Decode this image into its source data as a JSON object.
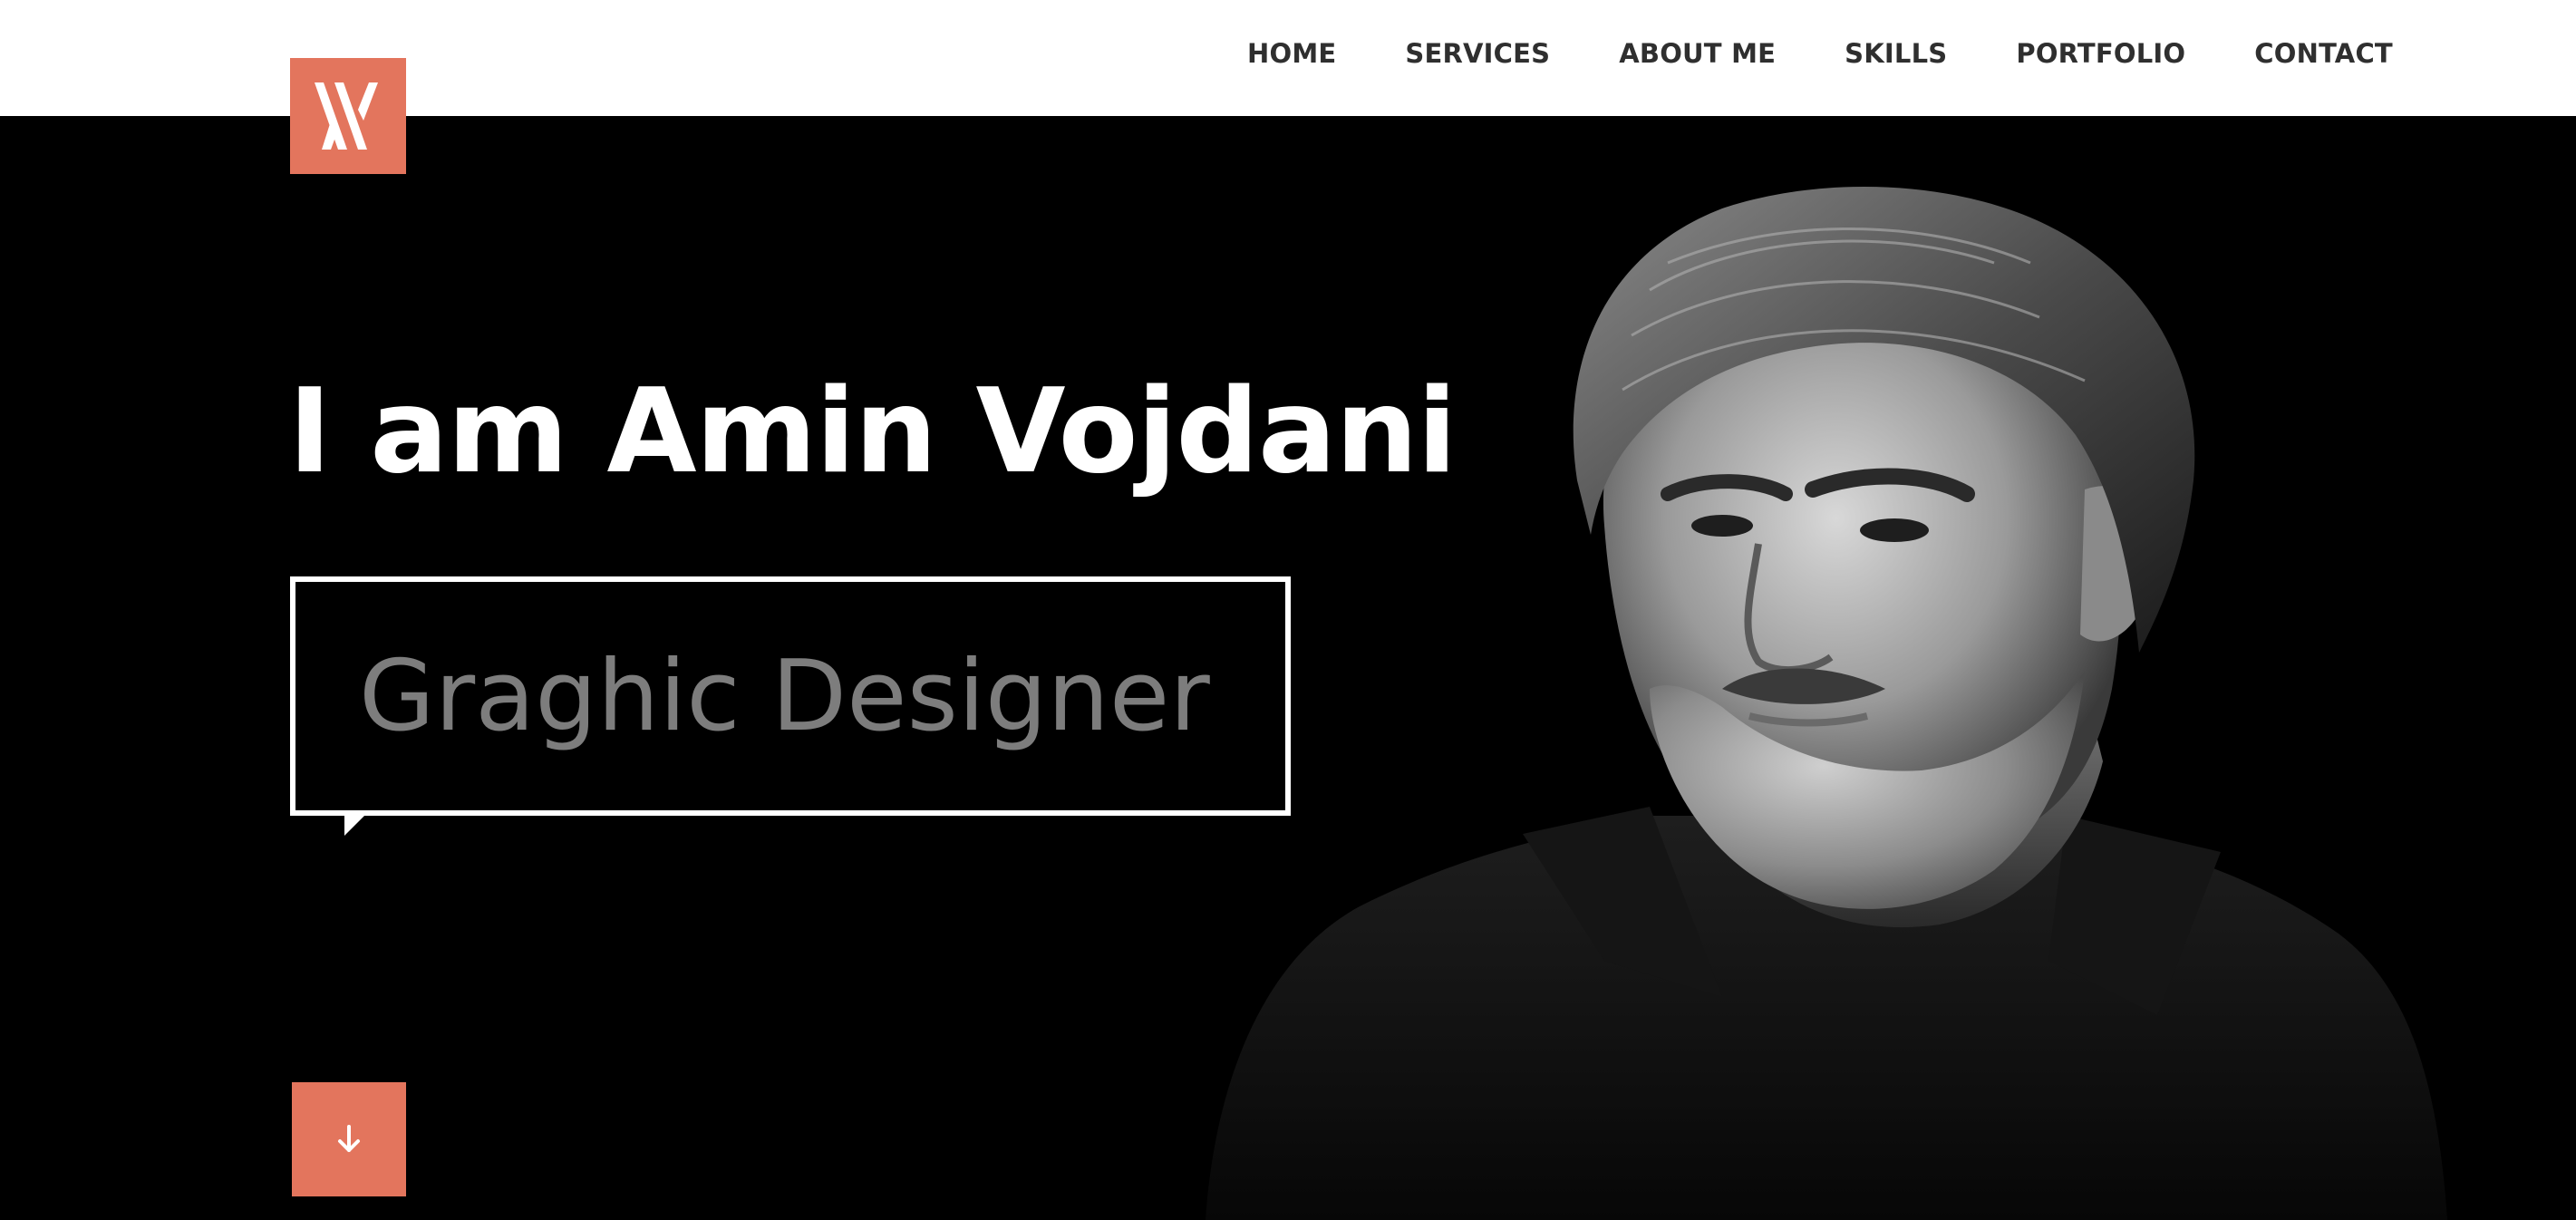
{
  "nav": {
    "items": [
      {
        "label": "HOME"
      },
      {
        "label": "SERVICES"
      },
      {
        "label": "ABOUT ME"
      },
      {
        "label": "SKILLS"
      },
      {
        "label": "PORTFOLIO"
      },
      {
        "label": "CONTACT"
      }
    ]
  },
  "logo": {
    "icon": "monogram-logo",
    "color": "#e3755d"
  },
  "hero": {
    "title": "I am Amin Vojdani",
    "role": "Graghic Designer",
    "scroll_icon": "arrow-down-icon"
  },
  "colors": {
    "accent": "#e3755d",
    "background": "#000000",
    "header_bg": "#ffffff",
    "nav_text": "#2f2f2f",
    "role_text": "#7d7d7d"
  }
}
